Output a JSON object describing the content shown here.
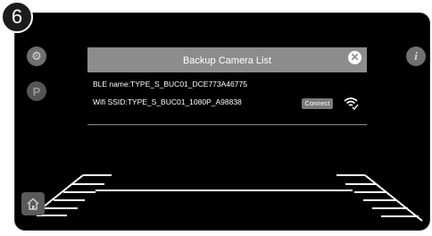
{
  "step_number": "6",
  "dialog": {
    "title": "Backup Camera List",
    "close_icon": "close-circle-icon",
    "ble_name": "BLE name:TYPE_S_BUC01_DCE773A46775",
    "wifi_ssid": "Wifi SSID:TYPE_S_BUC01_1080P_A98838",
    "connect_label": "Connect",
    "status_icon": "wifi-check-icon"
  },
  "left_icons": [
    "gear-icon",
    "parking-icon"
  ],
  "right_icons": [
    "info-icon"
  ],
  "home_icon": "home-icon"
}
